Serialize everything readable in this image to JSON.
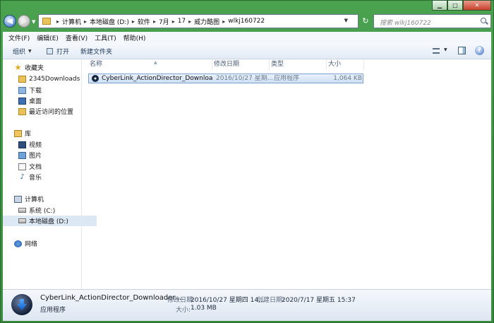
{
  "window": {
    "controls": {
      "minimize": "▁",
      "maximize": "□",
      "close": "✕"
    }
  },
  "address": {
    "crumbs": [
      "计算机",
      "本地磁盘 (D:)",
      "软件",
      "7月",
      "17",
      "威力酷图",
      "wlkj160722"
    ],
    "search_placeholder": "搜索 wlkj160722"
  },
  "menubar": {
    "items": [
      "文件(F)",
      "编辑(E)",
      "查看(V)",
      "工具(T)",
      "帮助(H)"
    ]
  },
  "toolbar": {
    "organize": "组织",
    "open": "打开",
    "new_folder": "新建文件夹"
  },
  "navpane": {
    "favorites": "收藏夹",
    "fav_items": [
      "2345Downloads",
      "下载",
      "桌面",
      "最近访问的位置"
    ],
    "libraries": "库",
    "lib_items": [
      "视频",
      "图片",
      "文档",
      "音乐"
    ],
    "computer": "计算机",
    "comp_items": [
      "系统 (C:)",
      "本地磁盘 (D:)"
    ],
    "network": "网络"
  },
  "filelist": {
    "columns": [
      "名称",
      "修改日期",
      "类型",
      "大小"
    ],
    "rows": [
      {
        "name": "CyberLink_ActionDirector_Downloade...",
        "modified": "2016/10/27 星期...",
        "type": "应用程序",
        "size": "1,064 KB"
      }
    ]
  },
  "details": {
    "name": "CyberLink_ActionDirector_Downloader....",
    "kind": "应用程序",
    "modified_label": "修改日期:",
    "modified_value": "2016/10/27 星期四 14...",
    "created_label": "创建日期:",
    "created_value": "2020/7/17 星期五 15:37",
    "size_label": "大小:",
    "size_value": "1.03 MB"
  },
  "colors": {
    "frame": "#3f8f45",
    "selection": "#cfe0f4",
    "toolbar": "#e3ebf6"
  }
}
